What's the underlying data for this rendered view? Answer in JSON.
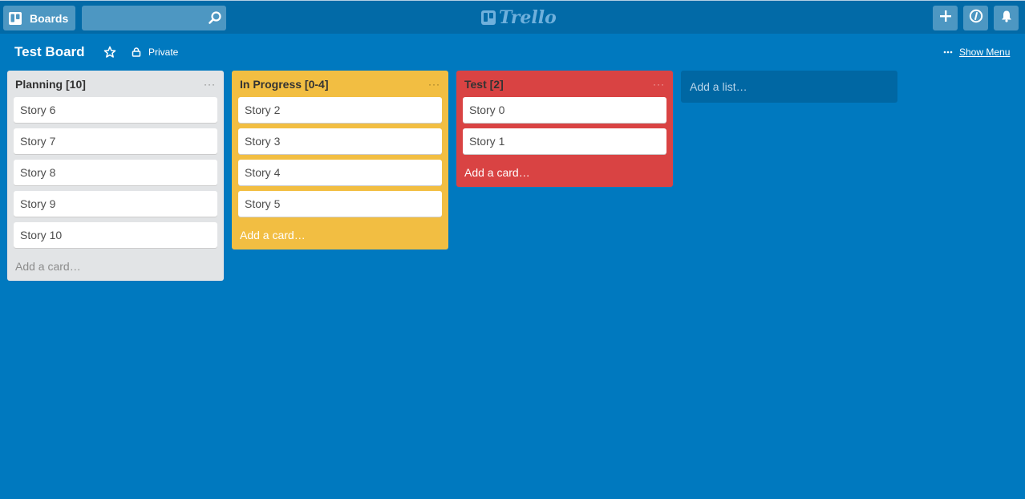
{
  "header": {
    "boards_label": "Boards",
    "search_placeholder": "",
    "logo_text": "Trello"
  },
  "board": {
    "title": "Test Board",
    "visibility": "Private",
    "show_menu": "Show Menu"
  },
  "lists": [
    {
      "title": "Planning [10]",
      "color": "#e2e4e6",
      "cards": [
        "Story 6",
        "Story 7",
        "Story 8",
        "Story 9",
        "Story 10"
      ],
      "add_card": "Add a card…"
    },
    {
      "title": "In Progress [0-4]",
      "color": "#f2be42",
      "cards": [
        "Story 2",
        "Story 3",
        "Story 4",
        "Story 5"
      ],
      "add_card": "Add a card…"
    },
    {
      "title": "Test [2]",
      "color": "#d94343",
      "cards": [
        "Story 0",
        "Story 1"
      ],
      "add_card": "Add a card…"
    }
  ],
  "add_list": "Add a list…",
  "colors": {
    "board_bg": "#0079bf",
    "header_bg": "#026aa7"
  },
  "icons": {
    "boards": "boards-icon",
    "search": "search-icon",
    "logo": "trello-logo-icon",
    "add": "plus-icon",
    "info": "info-icon",
    "notifications": "bell-icon",
    "star": "star-icon",
    "private": "lock-icon",
    "menu": "ellipsis-icon"
  }
}
